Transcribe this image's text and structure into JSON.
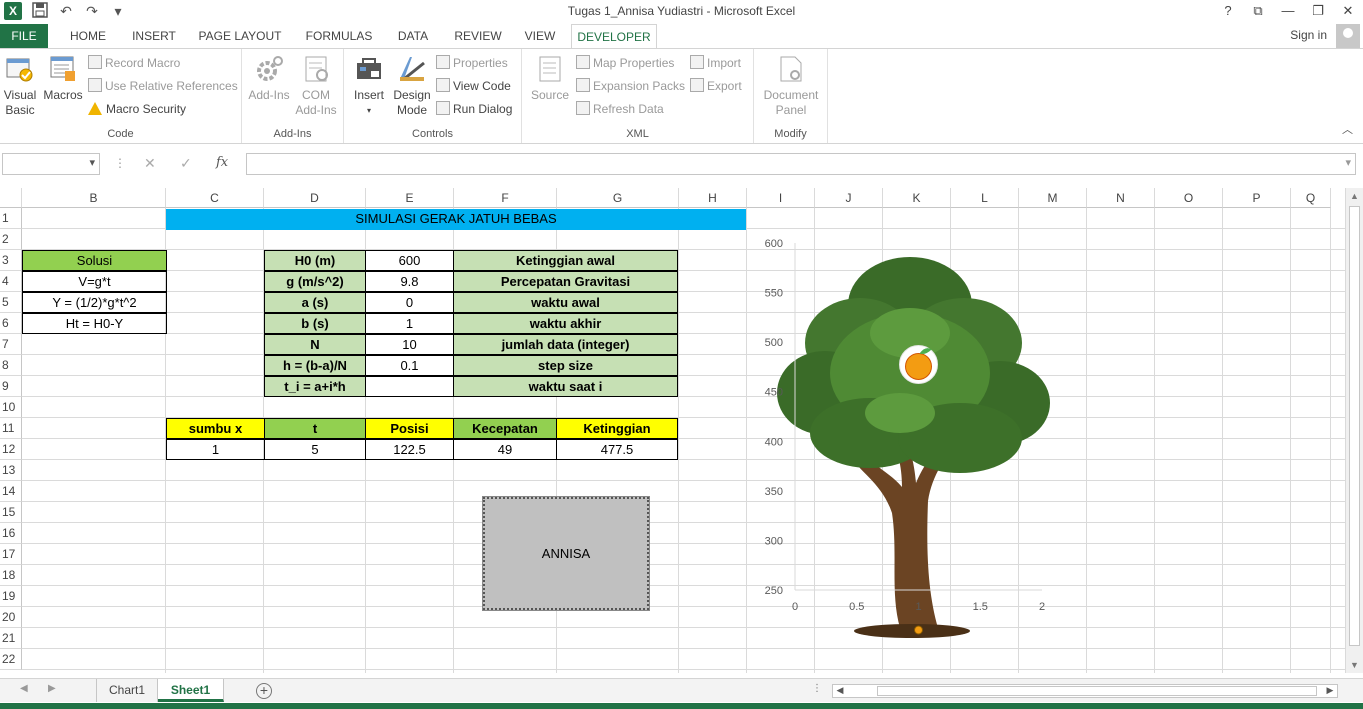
{
  "window": {
    "title": "Tugas 1_Annisa Yudiastri - Microsoft Excel",
    "help": "?",
    "controls": [
      "⧉",
      "—",
      "❐",
      "✕"
    ]
  },
  "qat": {
    "app_icon": "X",
    "save": "💾",
    "undo": "↶",
    "redo": "↷",
    "customize": "▾"
  },
  "tabs": [
    "FILE",
    "HOME",
    "INSERT",
    "PAGE LAYOUT",
    "FORMULAS",
    "DATA",
    "REVIEW",
    "VIEW",
    "DEVELOPER"
  ],
  "active_tab": "DEVELOPER",
  "account": {
    "sign_in": "Sign in"
  },
  "ribbon": {
    "code": {
      "label": "Code",
      "visual_basic": [
        "Visual",
        "Basic"
      ],
      "macros": "Macros",
      "record_macro": "Record Macro",
      "relative_refs": "Use Relative References",
      "macro_security": "Macro Security"
    },
    "addins": {
      "label": "Add-Ins",
      "addins": "Add-Ins",
      "com_addins": [
        "COM",
        "Add-Ins"
      ]
    },
    "controls": {
      "label": "Controls",
      "insert": "Insert",
      "design_mode": [
        "Design",
        "Mode"
      ],
      "properties": "Properties",
      "view_code": "View Code",
      "run_dialog": "Run Dialog"
    },
    "xml": {
      "label": "XML",
      "source": "Source",
      "map_properties": "Map Properties",
      "expansion_packs": "Expansion Packs",
      "refresh_data": "Refresh Data",
      "import": "Import",
      "export": "Export"
    },
    "modify": {
      "label": "Modify",
      "document_panel": [
        "Document",
        "Panel"
      ]
    }
  },
  "formula_bar": {
    "name_box": "",
    "fx": "fx",
    "cancel": "✕",
    "enter": "✓",
    "value": ""
  },
  "columns": [
    "B",
    "C",
    "D",
    "E",
    "F",
    "G",
    "H",
    "I",
    "J",
    "K",
    "L",
    "M",
    "N",
    "O",
    "P",
    "Q"
  ],
  "rows": [
    "1",
    "2",
    "3",
    "4",
    "5",
    "6",
    "7",
    "8",
    "9",
    "10",
    "11",
    "12",
    "13",
    "14",
    "15",
    "16",
    "17",
    "18",
    "19",
    "20",
    "21",
    "22"
  ],
  "sheet": {
    "banner": "SIMULASI GERAK JATUH BEBAS",
    "solusi": {
      "header": "Solusi",
      "lines": [
        "V=g*t",
        "Y = (1/2)*g*t^2",
        "Ht = H0-Y"
      ]
    },
    "params": [
      {
        "label": "H0 (m)",
        "value": "600",
        "desc": "Ketinggian awal"
      },
      {
        "label": "g (m/s^2)",
        "value": "9.8",
        "desc": "Percepatan Gravitasi"
      },
      {
        "label": "a (s)",
        "value": "0",
        "desc": "waktu awal"
      },
      {
        "label": "b (s)",
        "value": "1",
        "desc": "waktu akhir"
      },
      {
        "label": "N",
        "value": "10",
        "desc": "jumlah data (integer)"
      },
      {
        "label": "h = (b-a)/N",
        "value": "0.1",
        "desc": "step size"
      },
      {
        "label": "t_i = a+i*h",
        "value": "",
        "desc": "waktu saat i"
      }
    ],
    "results": {
      "headers": [
        "sumbu x",
        "t",
        "Posisi",
        "Kecepatan",
        "Ketinggian"
      ],
      "row": [
        "1",
        "5",
        "122.5",
        "49",
        "477.5"
      ]
    },
    "macro_button": "ANNISA"
  },
  "chart_data": {
    "type": "scatter",
    "x_ticks": [
      "0",
      "0.5",
      "1",
      "1.5",
      "2"
    ],
    "y_ticks": [
      "250",
      "300",
      "350",
      "400",
      "450",
      "500",
      "550",
      "600"
    ],
    "xlim": [
      0,
      2
    ],
    "ylim": [
      250,
      600
    ],
    "grid": false,
    "background": "tree image",
    "series": [
      {
        "x": [
          1,
          1
        ],
        "y": [
          477.5,
          250
        ]
      }
    ]
  },
  "sheet_tabs": [
    "Chart1",
    "Sheet1"
  ],
  "active_sheet": "Sheet1",
  "colors": {
    "excel_green": "#217346",
    "header_green": "#92d050",
    "light_green": "#c6e0b4",
    "yellow": "#ffff00",
    "banner_blue": "#00b0f0"
  }
}
